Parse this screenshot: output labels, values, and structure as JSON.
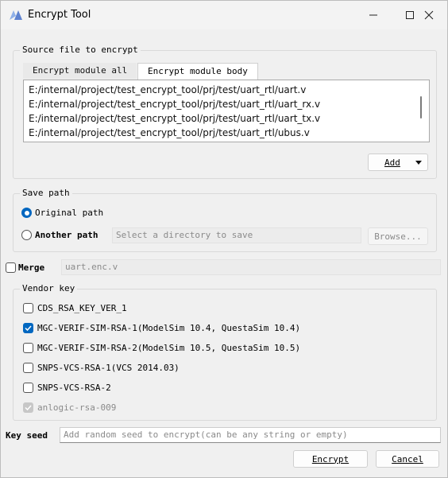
{
  "window": {
    "title": "Encrypt Tool"
  },
  "source": {
    "legend": "Source file to encrypt",
    "tabs": [
      {
        "label": "Encrypt module all",
        "active": false
      },
      {
        "label": "Encrypt module body",
        "active": true
      }
    ],
    "files": [
      "E:/internal/project/test_encrypt_tool/prj/test/uart_rtl/uart.v",
      "E:/internal/project/test_encrypt_tool/prj/test/uart_rtl/uart_rx.v",
      "E:/internal/project/test_encrypt_tool/prj/test/uart_rtl/uart_tx.v",
      "E:/internal/project/test_encrypt_tool/prj/test/uart_rtl/ubus.v"
    ],
    "add_label": "Add"
  },
  "save": {
    "legend": "Save path",
    "original_label": "Original path",
    "another_label": "Another path",
    "dir_placeholder": "Select a directory to save",
    "browse_label": "Browse..."
  },
  "merge": {
    "label": "Merge",
    "filename": "uart.enc.v"
  },
  "vendor": {
    "legend": "Vendor key",
    "keys": [
      {
        "label": "CDS_RSA_KEY_VER_1",
        "checked": false
      },
      {
        "label": "MGC-VERIF-SIM-RSA-1(ModelSim 10.4, QuestaSim 10.4)",
        "checked": true
      },
      {
        "label": "MGC-VERIF-SIM-RSA-2(ModelSim 10.5, QuestaSim 10.5)",
        "checked": false
      },
      {
        "label": "SNPS-VCS-RSA-1(VCS 2014.03)",
        "checked": false
      },
      {
        "label": "SNPS-VCS-RSA-2",
        "checked": false
      },
      {
        "label": "anlogic-rsa-009",
        "checked": true,
        "disabled": true
      }
    ]
  },
  "seed": {
    "label": "Key seed",
    "placeholder": "Add random seed to encrypt(can be any string or empty)"
  },
  "actions": {
    "encrypt_label": "Encrypt",
    "cancel_label": "Cancel"
  },
  "colors": {
    "accent": "#0067c0",
    "background": "#f0f0f0",
    "icon": "#6f8fd0"
  }
}
